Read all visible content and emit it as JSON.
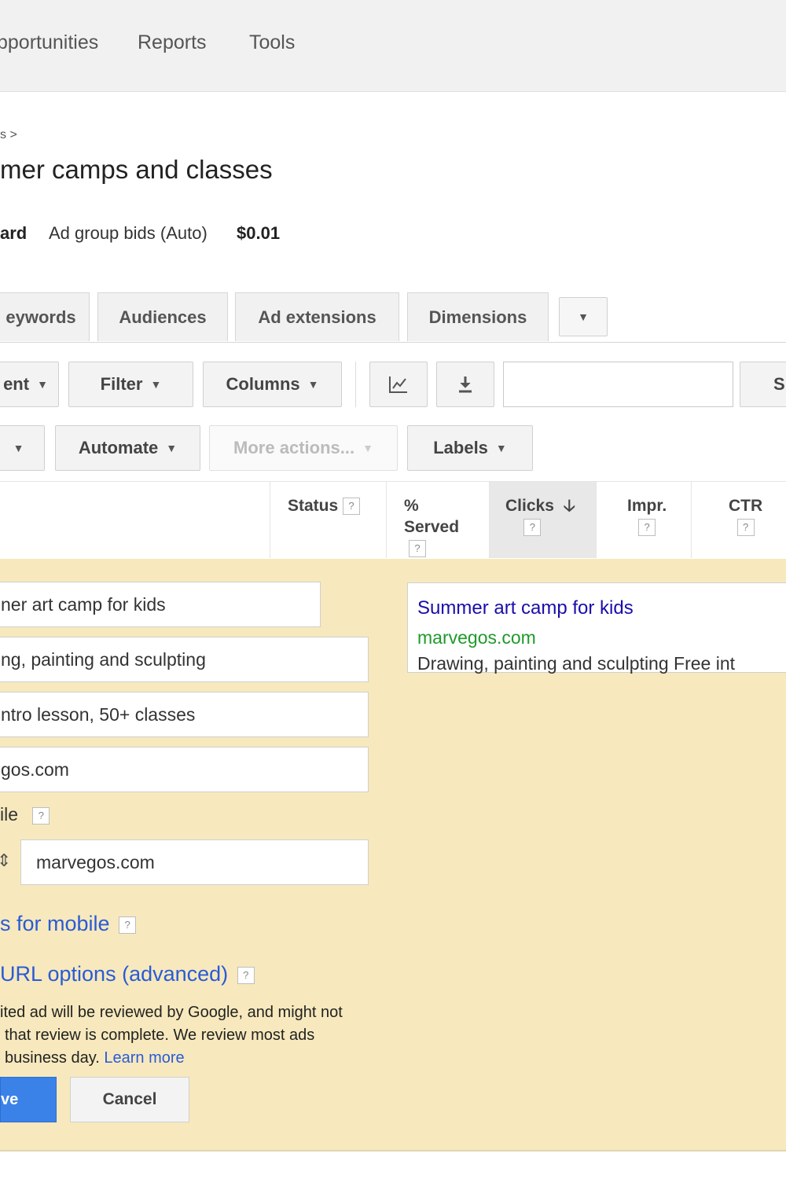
{
  "nav": {
    "opportunities": "pportunities",
    "reports": "Reports",
    "tools": "Tools"
  },
  "breadcrumb": "s >",
  "page_title": "mer camps and classes",
  "bid": {
    "left_label": "ard",
    "label": "Ad group bids (Auto)",
    "value": "$0.01"
  },
  "tabs": {
    "keywords": "eywords",
    "audiences": "Audiences",
    "ad_extensions": "Ad extensions",
    "dimensions": "Dimensions"
  },
  "toolbar": {
    "segment": "ent",
    "filter": "Filter",
    "columns": "Columns",
    "search_value": "",
    "search_button": "S",
    "automate": "Automate",
    "more_actions": "More actions...",
    "labels": "Labels"
  },
  "columns": {
    "status": "Status",
    "served_line1": "%",
    "served_line2": "Served",
    "clicks": "Clicks",
    "impr": "Impr.",
    "ctr": "CTR",
    "help": "?"
  },
  "form": {
    "headline": "ner art camp for kids",
    "description1": "ng, painting and sculpting",
    "description2": "ntro lesson, 50+ classes",
    "display_url": "gos.com",
    "mobile_label": "ile",
    "final_url_value": "marvegos.com",
    "urls_for_mobile": "s for mobile",
    "url_options": "URL options (advanced)"
  },
  "preview": {
    "headline": "Summer art camp for kids",
    "url": "marvegos.com",
    "description": "Drawing, painting and sculpting Free int"
  },
  "review": {
    "line1": "ited ad will be reviewed by Google, and might not",
    "line2": "that review is complete. We review most ads",
    "line3": "business day.",
    "learn_more": "Learn more"
  },
  "buttons": {
    "save": "ve",
    "cancel": "Cancel"
  },
  "colors": {
    "panel_bg": "#f7e9bd",
    "link": "#2a5bd7",
    "ad_headline": "#1a0dab",
    "ad_url": "#1e9a2a",
    "save_button": "#3b82e8"
  }
}
